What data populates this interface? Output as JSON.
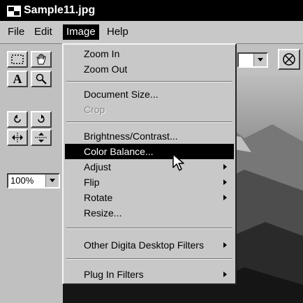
{
  "window": {
    "title": "Sample11.jpg"
  },
  "menubar": {
    "items": [
      "File",
      "Edit",
      "Image",
      "Help"
    ]
  },
  "image_menu": {
    "items": [
      {
        "label": "Zoom In",
        "state": "normal"
      },
      {
        "label": "Zoom Out",
        "state": "normal"
      },
      {
        "label": "Document Size...",
        "state": "normal"
      },
      {
        "label": "Crop",
        "state": "disabled"
      },
      {
        "label": "Brightness/Contrast...",
        "state": "normal"
      },
      {
        "label": "Color Balance...",
        "state": "highlighted"
      },
      {
        "label": "Adjust",
        "state": "submenu"
      },
      {
        "label": "Flip",
        "state": "submenu"
      },
      {
        "label": "Rotate",
        "state": "submenu"
      },
      {
        "label": "Resize...",
        "state": "normal"
      },
      {
        "label": "Other Digita Desktop Filters",
        "state": "submenu"
      },
      {
        "label": "Plug In Filters",
        "state": "submenu"
      }
    ]
  },
  "toolbar": {
    "text_tool_label": "A",
    "zoom_value": "100%"
  },
  "colors": {
    "title_bar": "#000000",
    "menu_bg": "#c8c8c8",
    "highlight": "#000000",
    "highlight_text": "#ffffff",
    "disabled_text": "#888888"
  }
}
